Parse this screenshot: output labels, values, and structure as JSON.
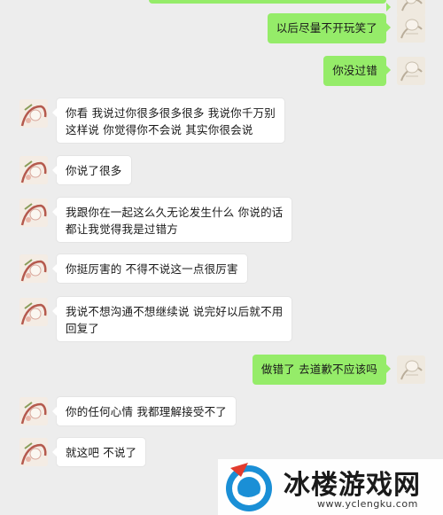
{
  "messages": [
    {
      "side": "right",
      "text": "以后尽量不开玩笑了"
    },
    {
      "side": "right",
      "text": "你没过错"
    },
    {
      "side": "left",
      "text": "你看 我说过你很多很多很多 我说你千万别\n这样说 你觉得你不会说 其实你很会说"
    },
    {
      "side": "left",
      "text": "你说了很多"
    },
    {
      "side": "left",
      "text": "我跟你在一起这么久无论发生什么 你说的话\n都让我觉得我是过错方"
    },
    {
      "side": "left",
      "text": "你挺厉害的 不得不说这一点很厉害"
    },
    {
      "side": "left",
      "text": "我说不想沟通不想继续说 说完好以后就不用\n回复了"
    },
    {
      "side": "right",
      "text": "做错了 去道歉不应该吗"
    },
    {
      "side": "left",
      "text": "你的任何心情 我都理解接受不了"
    },
    {
      "side": "left",
      "text": "就这吧 不说了"
    }
  ],
  "watermark": {
    "title": "冰楼游戏网",
    "url": "www.yclengku.com"
  },
  "colors": {
    "background": "#ededed",
    "self_bubble": "#95ec69",
    "other_bubble": "#ffffff"
  },
  "icons": {
    "self_avatar": "sketch-avatar-icon",
    "other_avatar": "cartoon-avatar-icon",
    "watermark_logo": "blue-circle-logo-icon"
  }
}
